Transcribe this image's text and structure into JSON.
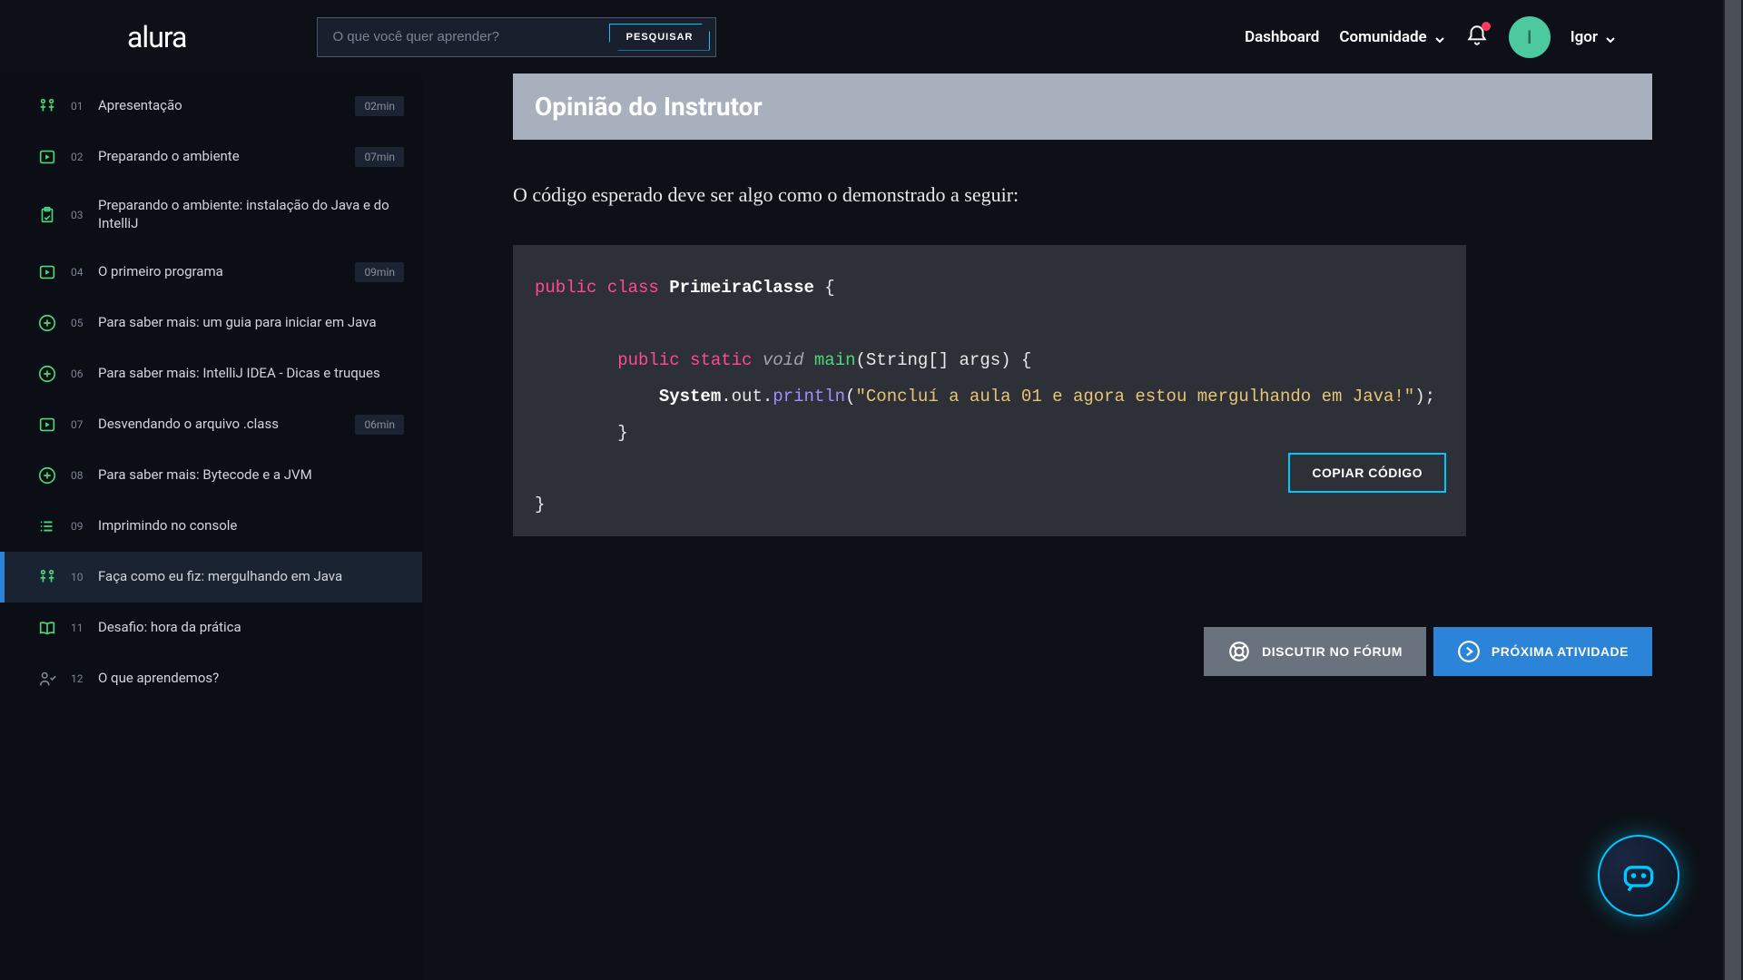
{
  "header": {
    "logo": "alura",
    "search_placeholder": "O que você quer aprender?",
    "search_button": "PESQUISAR",
    "dashboard": "Dashboard",
    "community": "Comunidade",
    "user_initial": "I",
    "user_name": "Igor"
  },
  "sidebar": {
    "items": [
      {
        "num": "01",
        "title": "Apresentação",
        "duration": "02min",
        "icon": "hands"
      },
      {
        "num": "02",
        "title": "Preparando o ambiente",
        "duration": "07min",
        "icon": "video"
      },
      {
        "num": "03",
        "title": "Preparando o ambiente: instalação do Java e do IntelliJ",
        "duration": "",
        "icon": "clipboard"
      },
      {
        "num": "04",
        "title": "O primeiro programa",
        "duration": "09min",
        "icon": "video"
      },
      {
        "num": "05",
        "title": "Para saber mais: um guia para iniciar em Java",
        "duration": "",
        "icon": "plus"
      },
      {
        "num": "06",
        "title": "Para saber mais: IntelliJ IDEA - Dicas e truques",
        "duration": "",
        "icon": "plus"
      },
      {
        "num": "07",
        "title": "Desvendando o arquivo .class",
        "duration": "06min",
        "icon": "video"
      },
      {
        "num": "08",
        "title": "Para saber mais: Bytecode e a JVM",
        "duration": "",
        "icon": "plus"
      },
      {
        "num": "09",
        "title": "Imprimindo no console",
        "duration": "",
        "icon": "list"
      },
      {
        "num": "10",
        "title": "Faça como eu fiz: mergulhando em Java",
        "duration": "",
        "icon": "hands",
        "active": true
      },
      {
        "num": "11",
        "title": "Desafio: hora da prática",
        "duration": "",
        "icon": "book"
      },
      {
        "num": "12",
        "title": "O que aprendemos?",
        "duration": "",
        "icon": "person"
      }
    ]
  },
  "content": {
    "instructor_banner": "Opinião do Instrutor",
    "intro_text": "O código esperado deve ser algo como o demonstrado a seguir:",
    "code": {
      "keywords": {
        "public": "public",
        "class": "class",
        "static": "static"
      },
      "type_void": "void",
      "class_name": "PrimeiraClasse",
      "fn_main": "main",
      "args": "(String[] args) {",
      "system": "System",
      "dot_out": ".out.",
      "println": "println",
      "string": "\"Concluí a aula 01 e agora estou mergulhando em Java!\"",
      "open_brace": " {",
      "close_brace": "}",
      "indent_close": "        }"
    },
    "copy_button": "COPIAR CÓDIGO",
    "forum_button": "DISCUTIR NO FÓRUM",
    "next_button": "PRÓXIMA ATIVIDADE"
  }
}
